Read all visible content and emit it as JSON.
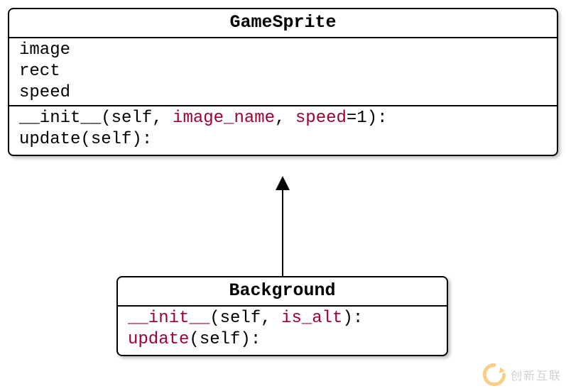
{
  "diagram": {
    "class1": {
      "name": "GameSprite",
      "attrs": [
        "image",
        "rect",
        "speed"
      ],
      "methods": {
        "m0": {
          "prefix": "__init__",
          "open": "(self, ",
          "p1": "image_name",
          "sep1": ", ",
          "p2": "speed",
          "tail": "=1):"
        },
        "m1": {
          "full": "update(self):"
        }
      }
    },
    "class2": {
      "name": "Background",
      "methods": {
        "m0": {
          "prefix": "__init__",
          "open": "(self, ",
          "p1": "is_alt",
          "tail": "):"
        },
        "m1": {
          "prefix": "update",
          "tail": "(self):"
        }
      }
    }
  },
  "watermark": {
    "text": "创新互联"
  }
}
